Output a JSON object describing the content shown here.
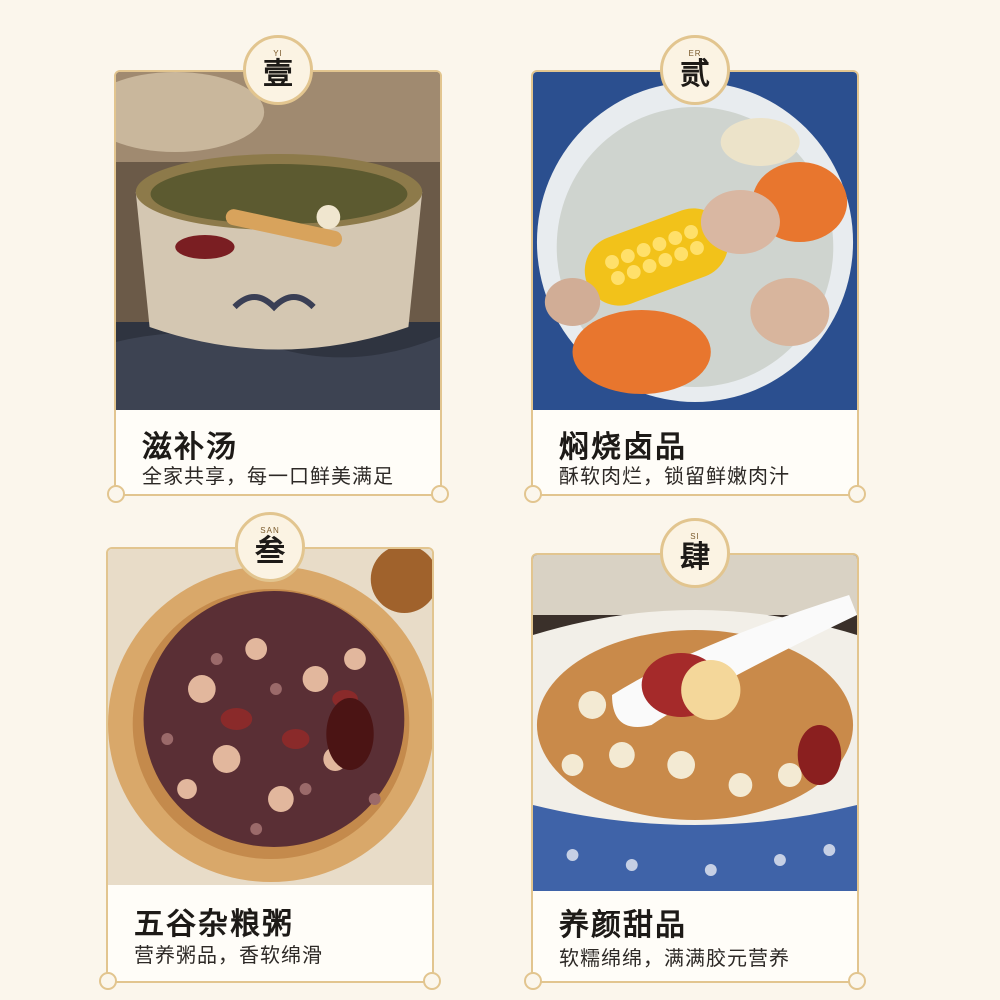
{
  "cards": [
    {
      "badge_pinyin": "YI",
      "badge_num": "壹",
      "title": "滋补汤",
      "subtitle": "全家共享，每一口鲜美满足",
      "photo_icon": "herbal-soup-bowl"
    },
    {
      "badge_pinyin": "ER",
      "badge_num": "贰",
      "title": "焖烧卤品",
      "subtitle": "酥软肉烂，锁留鲜嫩肉汁",
      "photo_icon": "corn-carrot-rib-soup"
    },
    {
      "badge_pinyin": "SAN",
      "badge_num": "叁",
      "title": "五谷杂粮粥",
      "subtitle": "营养粥品，香软绵滑",
      "photo_icon": "grain-porridge-wooden-bowl"
    },
    {
      "badge_pinyin": "SI",
      "badge_num": "肆",
      "title": "养颜甜品",
      "subtitle": "软糯绵绵，满满胶元营养",
      "photo_icon": "sweet-soup-with-spoon"
    }
  ],
  "colors": {
    "background": "#fbf6ec",
    "border_gold": "#e2c58f",
    "text_dark": "#1d1a17"
  }
}
